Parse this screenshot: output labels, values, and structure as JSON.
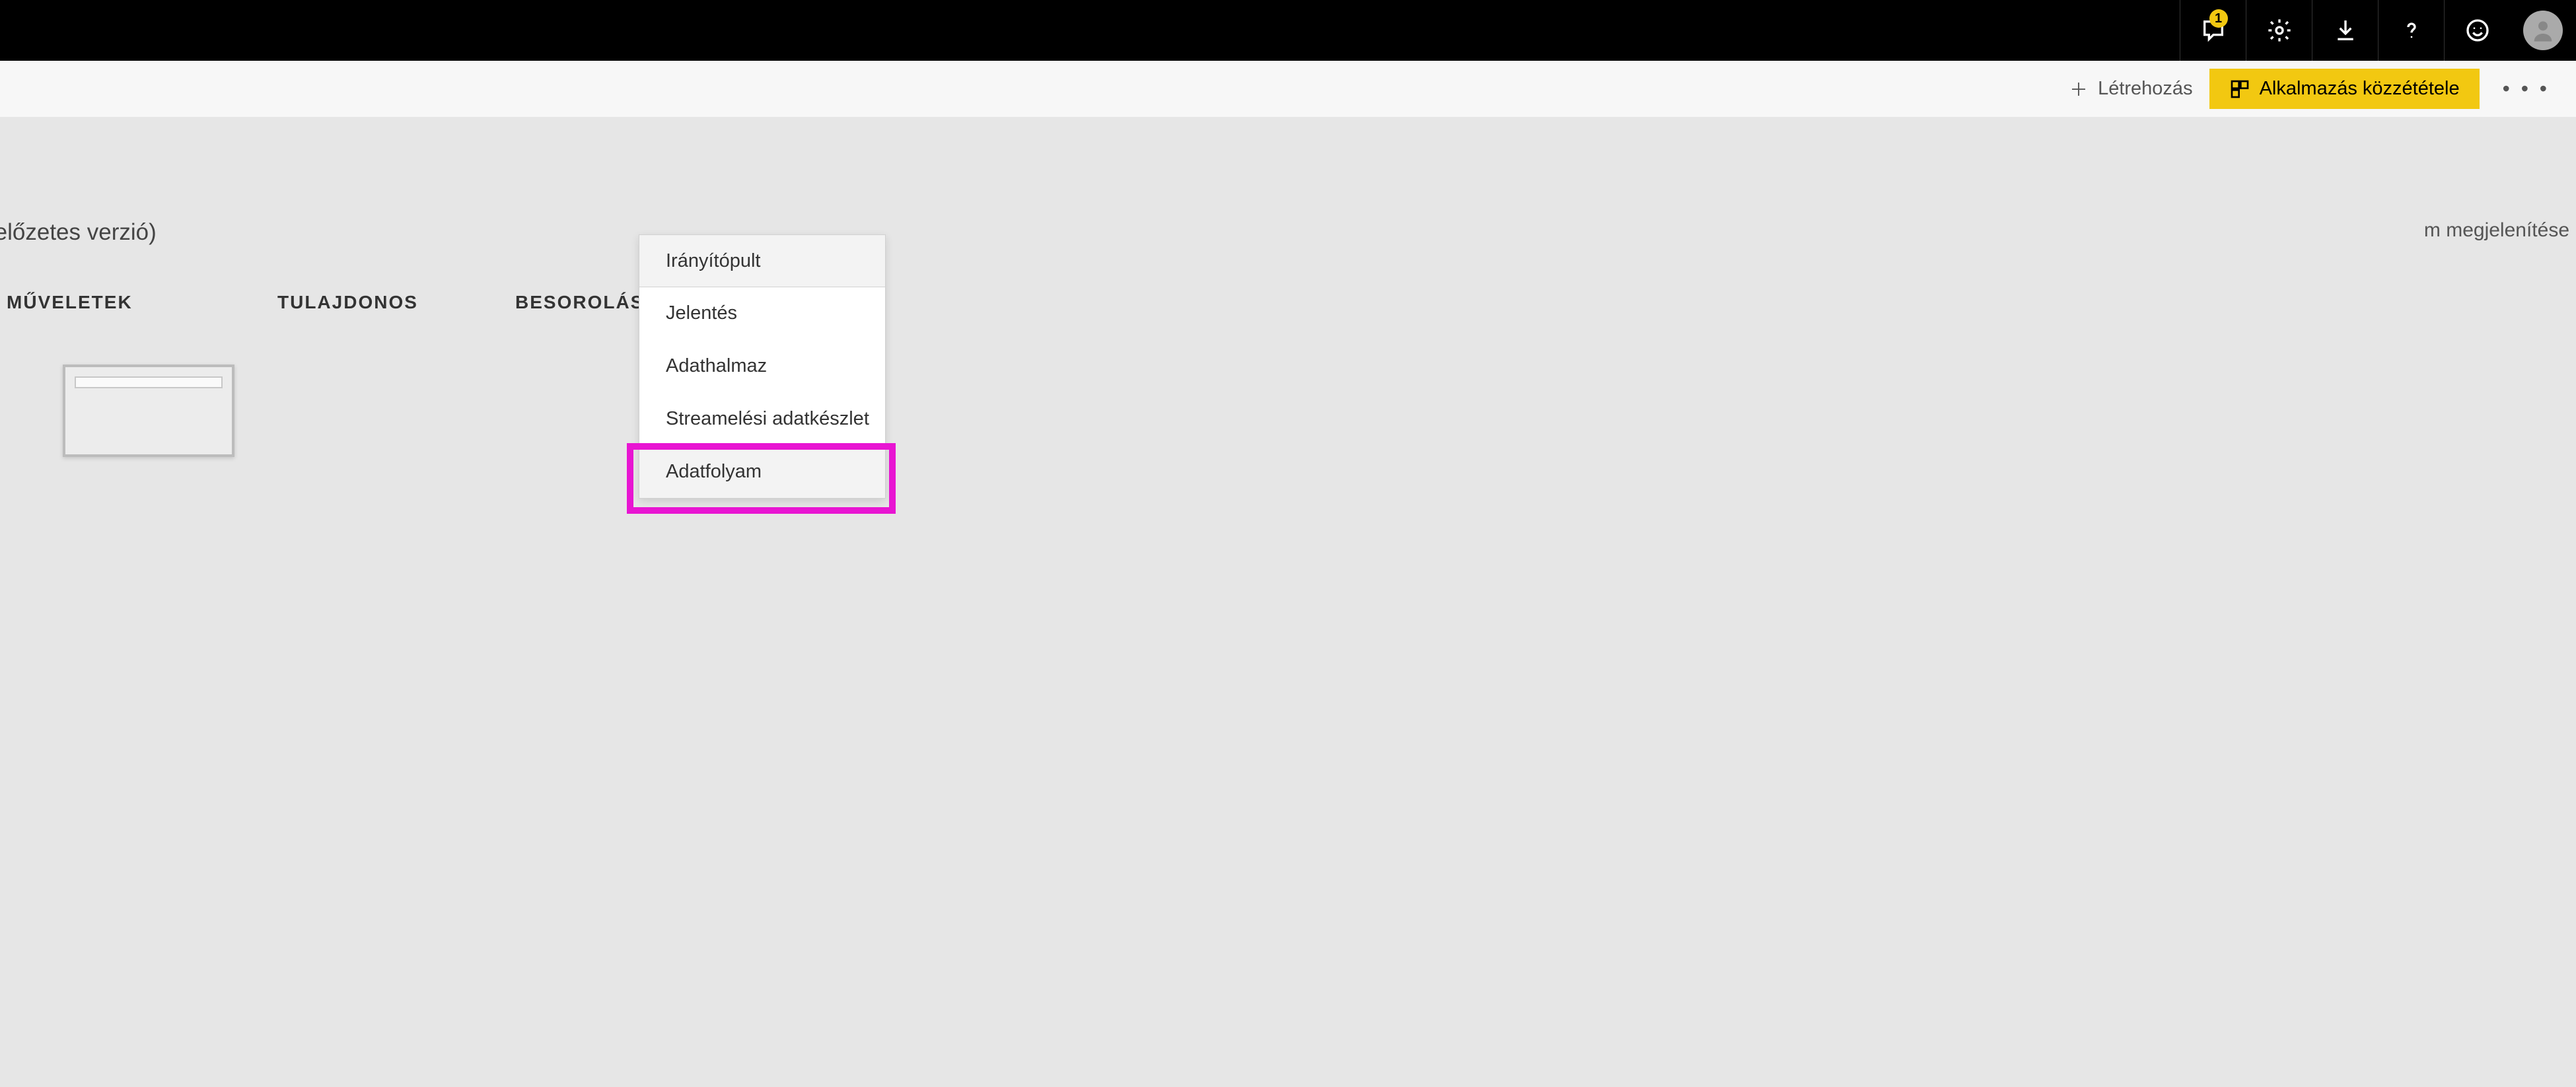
{
  "topbar": {
    "notification_count": "1"
  },
  "toolbar": {
    "create_label": "Létrehozás",
    "publish_label": "Alkalmazás közzététele"
  },
  "subtitle_cropped": "(előzetes verzió)",
  "side_label_cropped": "m megjelenítése",
  "columns": {
    "actions": "MŰVELETEK",
    "owner": "TULAJDONOS",
    "classification": "BESOROLÁS"
  },
  "dropdown": {
    "items": [
      "Irányítópult",
      "Jelentés",
      "Adathalmaz",
      "Streamelési adatkészlet",
      "Adatfolyam"
    ]
  }
}
